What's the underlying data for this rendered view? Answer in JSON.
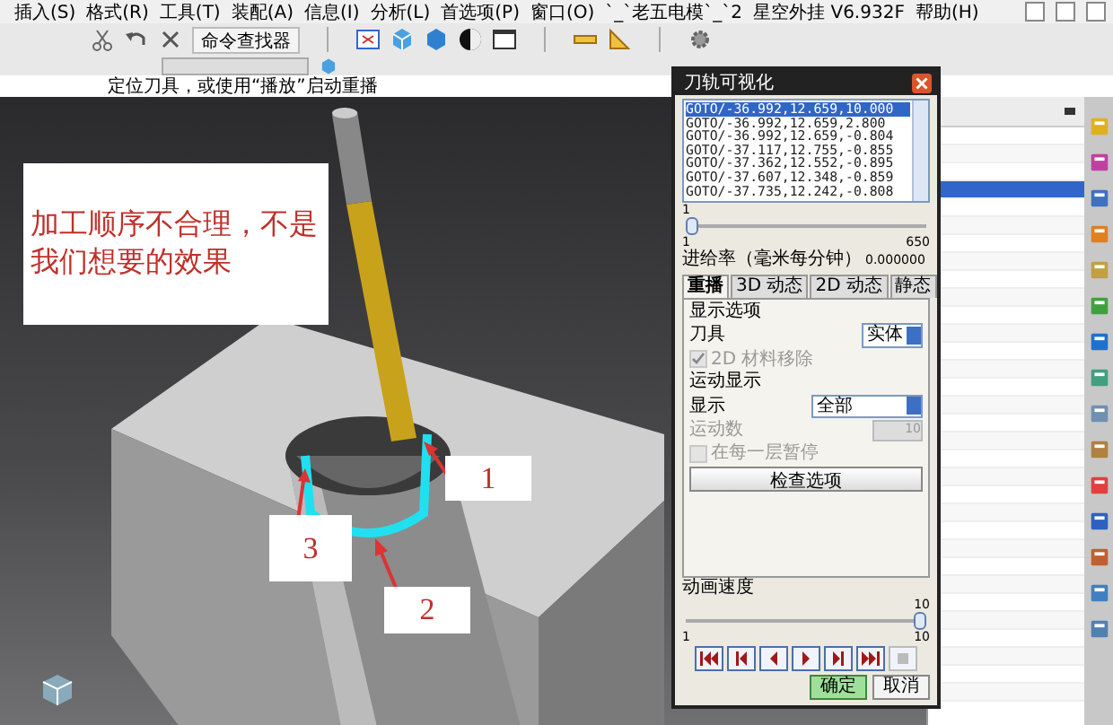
{
  "menu_bar": {
    "items": [
      "插入(S)",
      "格式(R)",
      "工具(T)",
      "装配(A)",
      "信息(I)",
      "分析(L)",
      "首选项(P)",
      "窗口(O)",
      "`_`老五电模`_`2",
      "星空外挂 V6.932F",
      "帮助(H)"
    ]
  },
  "toolbar": {
    "command_finder": "命令查找器"
  },
  "status_line": "定位刀具，或使用“播放”启动重播",
  "viewport": {
    "annotation": "加工顺序不合理，不是我们想要的效果",
    "callouts": [
      {
        "label": "1"
      },
      {
        "label": "3"
      },
      {
        "label": "2"
      }
    ]
  },
  "dialog": {
    "title": "刀轨可视化",
    "path_list": [
      {
        "text": "GOTO/-36.992,12.659,10.000",
        "selected": true
      },
      {
        "text": "GOTO/-36.992,12.659,2.800",
        "selected": false
      },
      {
        "text": "GOTO/-36.992,12.659,-0.804",
        "selected": false
      },
      {
        "text": "GOTO/-37.117,12.755,-0.855",
        "selected": false
      },
      {
        "text": "GOTO/-37.362,12.552,-0.895",
        "selected": false
      },
      {
        "text": "GOTO/-37.607,12.348,-0.859",
        "selected": false
      },
      {
        "text": "GOTO/-37.735,12.242,-0.808",
        "selected": false
      }
    ],
    "step_slider": {
      "value_label": "1",
      "min_label": "1",
      "max_label": "650",
      "level": 0
    },
    "feed_rate": {
      "label": "进给率（毫米每分钟）",
      "value": "0.000000"
    },
    "tabs": [
      {
        "label": "重播",
        "selected": true
      },
      {
        "label": "3D 动态",
        "selected": false
      },
      {
        "label": "2D 动态",
        "selected": false
      },
      {
        "label": "静态",
        "selected": false
      }
    ],
    "display_options": {
      "heading": "显示选项",
      "tool_label": "刀具",
      "tool_value": "实体",
      "material_removal": {
        "label": "2D 材料移除",
        "checked": true,
        "disabled": true
      }
    },
    "motion_display": {
      "heading": "运动显示",
      "display_label": "显示",
      "display_value": "全部",
      "motion_count_label": "运动数",
      "motion_count_value": "10",
      "pause_each_level": {
        "label": "在每一层暂停",
        "checked": false,
        "disabled": true
      }
    },
    "check_button": "检查选项",
    "animation_speed": {
      "label": "动画速度",
      "value_label": "10",
      "min_label": "1",
      "max_label": "10",
      "level": 1
    },
    "playback": {
      "stop_disabled": true
    },
    "ok_button": "确定",
    "cancel_button": "取消"
  },
  "navigator": {
    "rows": [
      {
        "selected": false
      },
      {
        "selected": false
      },
      {
        "selected": false
      },
      {
        "selected": true
      },
      {
        "selected": false
      },
      {
        "selected": false
      },
      {
        "selected": false
      },
      {
        "selected": false
      },
      {
        "selected": false
      },
      {
        "selected": false
      },
      {
        "selected": false
      },
      {
        "selected": false
      },
      {
        "selected": false
      },
      {
        "selected": false
      },
      {
        "selected": false
      },
      {
        "selected": false
      },
      {
        "selected": false
      },
      {
        "selected": false
      },
      {
        "selected": false
      },
      {
        "selected": false
      },
      {
        "selected": false
      },
      {
        "selected": false
      },
      {
        "selected": false
      },
      {
        "selected": false
      },
      {
        "selected": false
      },
      {
        "selected": false
      },
      {
        "selected": false
      },
      {
        "selected": false
      },
      {
        "selected": false
      },
      {
        "selected": false
      },
      {
        "selected": false
      },
      {
        "selected": false
      }
    ]
  }
}
